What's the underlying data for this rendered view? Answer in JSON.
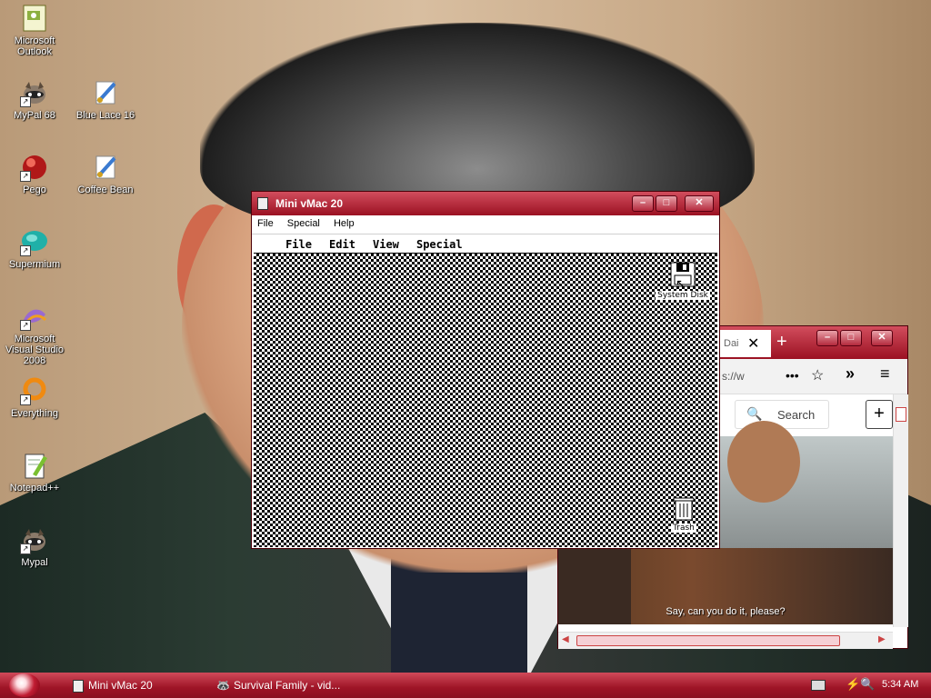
{
  "desktop": {
    "icons": [
      {
        "label": "Microsoft Outlook",
        "icon": "outlook-icon"
      },
      {
        "label": "MyPal 68",
        "icon": "raccoon-icon"
      },
      {
        "label": "Blue Lace 16",
        "icon": "paint-icon"
      },
      {
        "label": "Pego",
        "icon": "red-ball-icon"
      },
      {
        "label": "Coffee Bean",
        "icon": "paint-icon"
      },
      {
        "label": "Supermium",
        "icon": "supermium-icon"
      },
      {
        "label": "Microsoft Visual Studio 2008",
        "icon": "visual-studio-icon"
      },
      {
        "label": "Everything",
        "icon": "search-ring-icon"
      },
      {
        "label": "Notepad++",
        "icon": "notepad-icon"
      },
      {
        "label": "Mypal",
        "icon": "raccoon-icon"
      }
    ]
  },
  "vmac": {
    "title": "Mini vMac 20",
    "menu": [
      "File",
      "Special",
      "Help"
    ],
    "mac_menu": [
      "File",
      "Edit",
      "View",
      "Special"
    ],
    "disk_label": "System Disk",
    "trash_label": "Trash"
  },
  "browser": {
    "tab_title": "Dai",
    "address_text": "s://w",
    "search_label": "Search",
    "subtitle": "Say, can you do it, please?"
  },
  "taskbar": {
    "tasks": [
      "Mini vMac 20",
      "Survival Family - vid..."
    ],
    "clock": "5:34 AM"
  },
  "colors": {
    "accent": "#9b1122",
    "taskbar": "#b3192d"
  }
}
